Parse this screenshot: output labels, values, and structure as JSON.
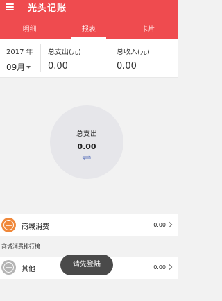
{
  "header": {
    "menu_icon": "menu-icon",
    "title": "光头记账",
    "tabs": [
      {
        "label": "明细",
        "active": false
      },
      {
        "label": "报表",
        "active": true
      },
      {
        "label": "卡片",
        "active": false
      }
    ]
  },
  "summary": {
    "year": "2017 年",
    "month": "09月",
    "expense_label": "总支出(元)",
    "expense_value": "0.00",
    "income_label": "总收入(元)",
    "income_value": "0.00"
  },
  "chart": {
    "center_label": "总支出",
    "center_value": "0.00",
    "switch_icon": "swap-arrows-icon",
    "fill_color": "#e6e6ea"
  },
  "categories": [
    {
      "name": "商城消费",
      "amount": "0.00",
      "icon": "more-dots-icon",
      "color": "#f0883a"
    },
    {
      "name": "其他",
      "amount": "0.00",
      "icon": "more-dots-icon",
      "color": "#b5b5b5"
    }
  ],
  "ranking_label": "商城消费排行榜",
  "toast": "请先登陆",
  "colors": {
    "brand": "#ef4b4f"
  }
}
